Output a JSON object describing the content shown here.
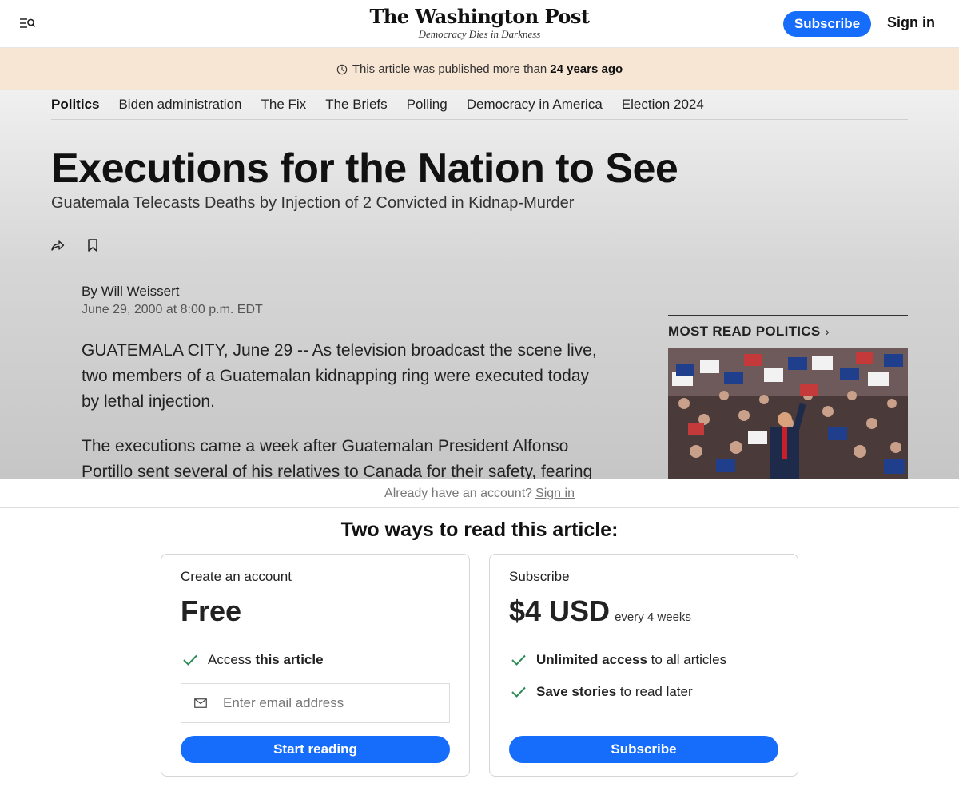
{
  "header": {
    "logo_title": "The Washington Post",
    "logo_tagline": "Democracy Dies in Darkness",
    "subscribe_label": "Subscribe",
    "signin_label": "Sign in"
  },
  "publish_banner": {
    "prefix": "This article was published more than",
    "age": "24 years ago"
  },
  "section_nav": [
    "Politics",
    "Biden administration",
    "The Fix",
    "The Briefs",
    "Polling",
    "Democracy in America",
    "Election 2024"
  ],
  "article": {
    "headline": "Executions for the Nation to See",
    "subheadline": "Guatemala Telecasts Deaths by Injection of 2 Convicted in Kidnap-Murder",
    "byline_prefix": "By",
    "author": "Will Weissert",
    "date": "June 29, 2000 at 8:00 p.m. EDT",
    "paragraphs": [
      "GUATEMALA CITY, June 29 -- As television broadcast the scene live, two members of a Guatemalan kidnapping ring were executed today by lethal injection.",
      "The executions came a week after Guatemalan President Alfonso Portillo sent several of his relatives to Canada for their safety, fearing"
    ]
  },
  "most_read": {
    "title": "MOST READ POLITICS",
    "chevron": "›"
  },
  "paywall": {
    "have_account": "Already have an account?",
    "signin_link": "Sign in",
    "heading": "Two ways to read this article:",
    "free": {
      "label": "Create an account",
      "price": "Free",
      "benefit_prefix": "Access",
      "benefit_bold": "this article",
      "email_placeholder": "Enter email address",
      "cta": "Start reading"
    },
    "subscribe": {
      "label": "Subscribe",
      "price": "$4 USD",
      "period": "every 4 weeks",
      "benefits": [
        {
          "bold": "Unlimited access",
          "rest": "to all articles"
        },
        {
          "bold": "Save stories",
          "rest": "to read later"
        }
      ],
      "cta": "Subscribe"
    }
  },
  "colors": {
    "accent": "#166dfc",
    "banner_bg": "#f8e6d5",
    "check": "#2e8b57"
  }
}
